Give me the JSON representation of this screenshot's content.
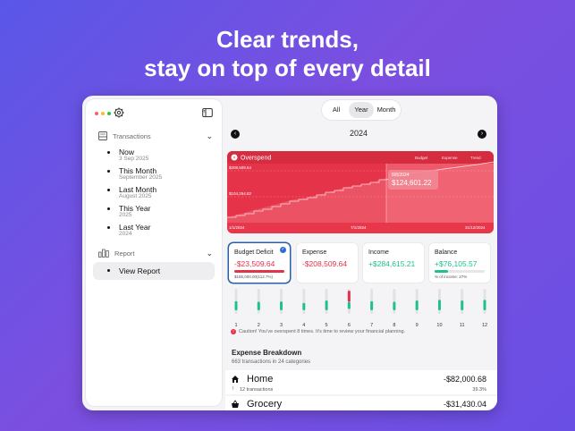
{
  "headline": {
    "line1": "Clear trends,",
    "line2": "stay on top of every detail"
  },
  "colors": {
    "red": "#e8364a",
    "green": "#1fbf8f",
    "blue": "#2b6cd6",
    "window_dots": [
      "#ff5f57",
      "#febc2e",
      "#28c840"
    ]
  },
  "sidebar": {
    "transactions_label": "Transactions",
    "items": [
      {
        "title": "Now",
        "subtitle": "3 Sep 2025"
      },
      {
        "title": "This Month",
        "subtitle": "September 2025"
      },
      {
        "title": "Last Month",
        "subtitle": "August 2025"
      },
      {
        "title": "This Year",
        "subtitle": "2025"
      },
      {
        "title": "Last Year",
        "subtitle": "2024"
      }
    ],
    "report_label": "Report",
    "view_report": "View Report"
  },
  "segmented": {
    "options": [
      "All",
      "Year",
      "Month"
    ],
    "active": "Year"
  },
  "year_nav": {
    "year": "2024"
  },
  "overspend": {
    "title": "Overspend",
    "legend": [
      "Budget",
      "Expense",
      "Trend"
    ],
    "y_top": "$208,509.64",
    "y_mid": "$104,254.82",
    "x_labels": [
      "1/1/2024",
      "7/1/2024",
      "31/12/2024"
    ],
    "tooltip_date": "8/8/2024",
    "tooltip_value": "$124,601.22",
    "progress_fraction": 0.6
  },
  "cards": [
    {
      "title": "Budget Deficit",
      "value": "-$23,509.64",
      "sub": "$185,000.00(112.7%)",
      "selected": true,
      "bar_fraction": 1.0
    },
    {
      "title": "Expense",
      "value": "-$208,509.64"
    },
    {
      "title": "Income",
      "value": "+$284,615.21"
    },
    {
      "title": "Balance",
      "value": "+$76,105.57",
      "sub": "% of income: 27%",
      "bar_fraction": 0.27
    }
  ],
  "months": {
    "labels": [
      "1",
      "2",
      "3",
      "4",
      "5",
      "6",
      "7",
      "8",
      "9",
      "10",
      "11",
      "12"
    ],
    "levels": [
      0.45,
      0.4,
      0.42,
      0.3,
      0.5,
      0.85,
      0.45,
      0.4,
      0.5,
      0.55,
      0.5,
      0.55
    ],
    "over": [
      false,
      false,
      false,
      false,
      false,
      true,
      false,
      false,
      false,
      false,
      false,
      false
    ]
  },
  "alert_text": "Caution! You've overspent 8 times. It's time to review your financial planning.",
  "breakdown": {
    "title": "Expense Breakdown",
    "subtitle": "663 transactions in 24 categories",
    "rows": [
      {
        "icon": "house-icon",
        "name": "Home",
        "amount": "-$82,000.68",
        "sub": "12 transactions",
        "pct": "39.3%"
      },
      {
        "icon": "basket-icon",
        "name": "Grocery",
        "amount": "-$31,430.04"
      }
    ]
  }
}
